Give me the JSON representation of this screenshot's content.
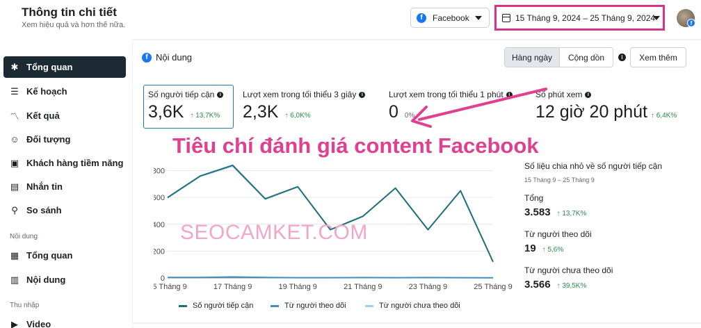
{
  "header": {
    "title": "Thông tin chi tiết",
    "subtitle": "Xem hiệu quả và hơn thế nữa.",
    "platform": "Facebook",
    "date_range": "15 Tháng 9, 2024 – 25 Tháng 9, 2024"
  },
  "sidebar": {
    "items": [
      {
        "label": "Tổng quan",
        "icon": "overview-icon"
      },
      {
        "label": "Kế hoạch",
        "icon": "plan-icon"
      },
      {
        "label": "Kết quả",
        "icon": "results-icon"
      },
      {
        "label": "Đối tượng",
        "icon": "audience-icon"
      },
      {
        "label": "Khách hàng tiềm năng",
        "icon": "leads-icon"
      },
      {
        "label": "Nhắn tin",
        "icon": "messages-icon"
      },
      {
        "label": "So sánh",
        "icon": "compare-icon"
      }
    ],
    "section_content": "Nội dung",
    "content_items": [
      {
        "label": "Tổng quan",
        "icon": "content-overview-icon"
      },
      {
        "label": "Nội dung",
        "icon": "content-table-icon"
      }
    ],
    "section_income": "Thu nhập",
    "income_items": [
      {
        "label": "Video",
        "icon": "video-icon"
      }
    ]
  },
  "content": {
    "title": "Nội dung",
    "toggle_daily": "Hàng ngày",
    "toggle_cumulative": "Cộng dồn",
    "see_more": "Xem thêm"
  },
  "metrics": [
    {
      "label": "Số người tiếp cận",
      "value": "3,6K",
      "delta": "↑ 13,7K%"
    },
    {
      "label": "Lượt xem trong tối thiểu 3 giây",
      "value": "2,3K",
      "delta": "↑ 6,0K%"
    },
    {
      "label": "Lượt xem trong tối thiểu 1 phút",
      "value": "0",
      "delta": "0%"
    },
    {
      "label": "Số phút xem",
      "value": "12 giờ 20 phút",
      "delta": "↑ 6,4K%"
    }
  ],
  "overlay": {
    "headline": "Tiêu chí đánh giá content Facebook",
    "watermark": "SEOCAMKET.COM"
  },
  "colors": {
    "accent_pink": "#d6338a",
    "series_reach": "#1f6f7a",
    "series_followers": "#3e8fbf",
    "series_non_followers": "#9fd0e6"
  },
  "chart_data": {
    "type": "line",
    "x": [
      "15 Tháng 9",
      "16 Tháng 9",
      "17 Tháng 9",
      "18 Tháng 9",
      "19 Tháng 9",
      "20 Tháng 9",
      "21 Tháng 9",
      "22 Tháng 9",
      "23 Tháng 9",
      "24 Tháng 9",
      "25 Tháng 9"
    ],
    "tick_labels": [
      "15 Tháng 9",
      "17 Tháng 9",
      "19 Tháng 9",
      "21 Tháng 9",
      "23 Tháng 9",
      "25 Tháng 9"
    ],
    "yticks": [
      "0",
      "200",
      "400",
      "600",
      "800"
    ],
    "ylim": [
      0,
      860
    ],
    "series": [
      {
        "name": "Số người tiếp cận",
        "values": [
          600,
          760,
          840,
          590,
          680,
          360,
          460,
          670,
          360,
          650,
          120
        ]
      },
      {
        "name": "Từ người theo dõi",
        "values": [
          4,
          4,
          8,
          4,
          2,
          2,
          3,
          2,
          3,
          2,
          1
        ]
      },
      {
        "name": "Từ người chưa theo dõi",
        "values": [
          596,
          756,
          832,
          586,
          678,
          358,
          457,
          668,
          357,
          648,
          119
        ]
      }
    ],
    "grid": true,
    "legend": "bottom"
  },
  "breakdown": {
    "title": "Số liệu chia nhỏ về số người tiếp cận",
    "date": "15 Tháng 9 – 25 Tháng 9",
    "rows": [
      {
        "label": "Tổng",
        "value": "3.583",
        "delta": "↑ 13,7K%"
      },
      {
        "label": "Từ người theo dõi",
        "value": "19",
        "delta": "↑ 5,6%"
      },
      {
        "label": "Từ người chưa theo dõi",
        "value": "3.566",
        "delta": "↑ 39,5K%"
      }
    ]
  }
}
